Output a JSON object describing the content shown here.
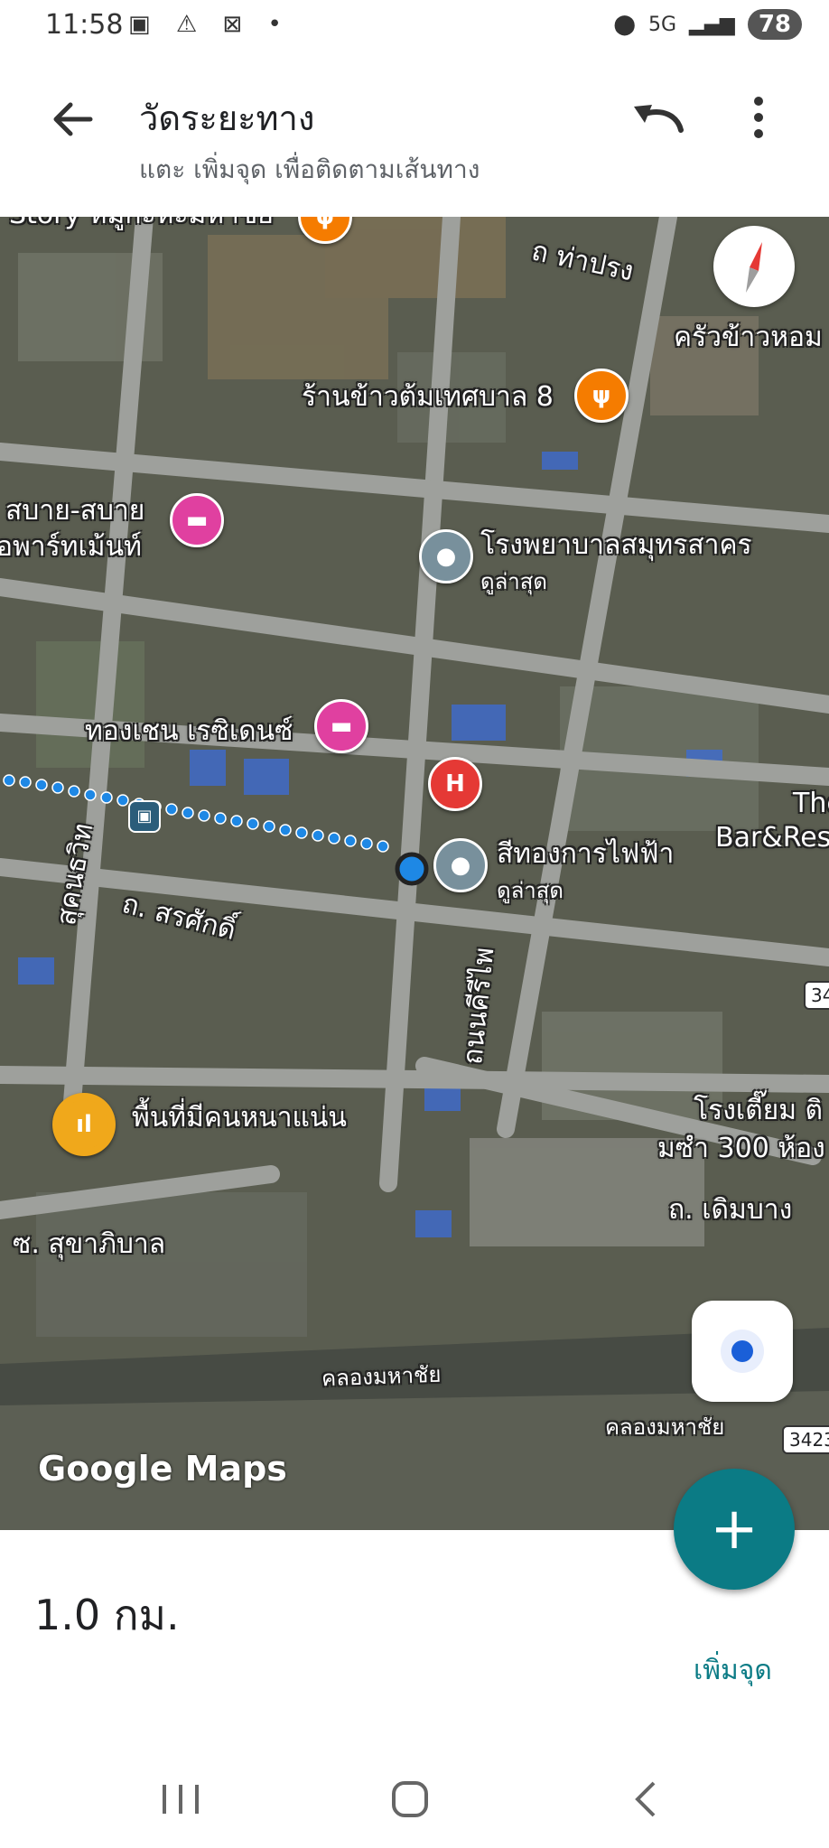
{
  "status_bar": {
    "time": "11:58",
    "network": "5G",
    "battery": "78"
  },
  "app_bar": {
    "title": "วัดระยะทาง",
    "subtitle": "แตะ เพิ่มจุด เพื่อติดตามเส้นทาง"
  },
  "map": {
    "labels": {
      "tha_prung": "ถ ท่าปรง",
      "krua_khao_hom": "ครัวข้าวหอม",
      "ran_khao_tom": "ร้านข้าวต้มเทศบาล 8",
      "sabai_1": "สบาย-สบาย",
      "sabai_2": "อพาร์ทเม้นท์",
      "hospital": "โรงพยาบาลสมุทรสาคร",
      "hospital_sub": "ดูล่าสุด",
      "thongchen": "ทองเชน เรซิเดนซ์",
      "bar_1": "The",
      "bar_2": "Bar&Rest",
      "sithong": "สีทองการไฟฟ้า",
      "sithong_sub": "ดูล่าสุด",
      "sukhumvit": "สุคนธวิท",
      "sorasak": "ถ. สรศักดิ์",
      "khiri": "ถนนคีรีไพ",
      "crowded": "พื้นที่มีคนหนาแน่น",
      "teng_1": "โรงเตี๊ยม ติ",
      "teng_2": "มซำ 300 ห้อง",
      "doem_bang": "ถ. เดิมบาง",
      "sukhaphiban": "ซ. สุขาภิบาล",
      "klong_1": "คลองมหาชัย",
      "klong_2": "คลองมหาชัย",
      "road_34": "34",
      "road_3423": "3423",
      "story": "Story หมู่กะหะมหาชย"
    },
    "watermark": "Google Maps"
  },
  "bottom_panel": {
    "distance": "1.0 กม.",
    "add_point_label": "เพิ่มจุด"
  },
  "colors": {
    "accent": "#0b7b85",
    "route_dot": "#1e88e5",
    "hotel_pin": "#e040a0",
    "food_pin": "#f57c00",
    "hospital_pin": "#e53935"
  }
}
